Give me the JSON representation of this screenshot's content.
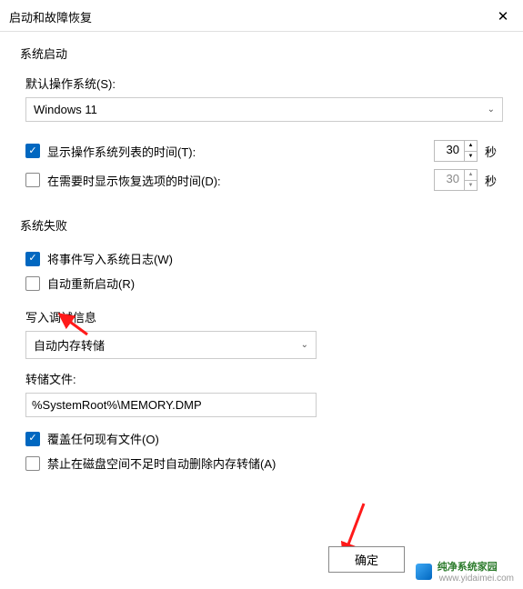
{
  "window": {
    "title": "启动和故障恢复"
  },
  "startup": {
    "section_title": "系统启动",
    "default_os_label": "默认操作系统(S):",
    "default_os_value": "Windows 11",
    "show_os_list_label": "显示操作系统列表的时间(T):",
    "show_os_list_checked": true,
    "show_os_list_seconds": "30",
    "show_recovery_label": "在需要时显示恢复选项的时间(D):",
    "show_recovery_checked": false,
    "show_recovery_seconds": "30",
    "seconds_unit": "秒"
  },
  "failure": {
    "section_title": "系统失败",
    "write_log_label": "将事件写入系统日志(W)",
    "write_log_checked": true,
    "auto_restart_label": "自动重新启动(R)",
    "auto_restart_checked": false,
    "debug_title": "写入调试信息",
    "debug_select_value": "自动内存转储",
    "dump_file_label": "转储文件:",
    "dump_file_value": "%SystemRoot%\\MEMORY.DMP",
    "overwrite_label": "覆盖任何现有文件(O)",
    "overwrite_checked": true,
    "disable_auto_delete_label": "禁止在磁盘空间不足时自动删除内存转储(A)",
    "disable_auto_delete_checked": false
  },
  "buttons": {
    "ok": "确定"
  },
  "watermark": {
    "line1": "纯净系统家园",
    "line2": "www.yidaimei.com"
  }
}
